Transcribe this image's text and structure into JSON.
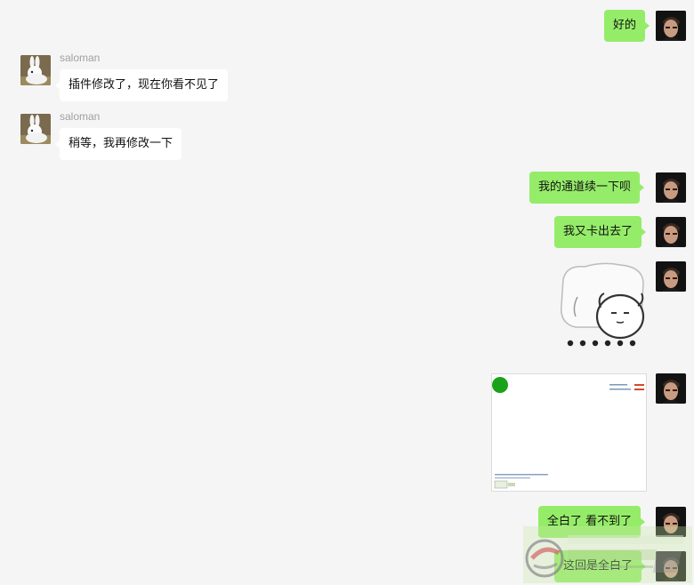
{
  "messages": [
    {
      "sender": "me",
      "type": "text",
      "text": "好的"
    },
    {
      "sender": "other",
      "type": "text",
      "name": "saloman",
      "text": "插件修改了，现在你看不见了"
    },
    {
      "sender": "other",
      "type": "text",
      "name": "saloman",
      "text": "稍等，我再修改一下"
    },
    {
      "sender": "me",
      "type": "text",
      "text": "我的通道续一下呗"
    },
    {
      "sender": "me",
      "type": "text",
      "text": "我又卡出去了"
    },
    {
      "sender": "me",
      "type": "image",
      "image": "cartoon-sticker"
    },
    {
      "sender": "me",
      "type": "image",
      "image": "screenshot"
    },
    {
      "sender": "me",
      "type": "text",
      "text": "全白了 看不到了"
    },
    {
      "sender": "me",
      "type": "text",
      "text": "这回是全白了"
    }
  ],
  "colors": {
    "background": "#f5f5f5",
    "my_bubble": "#95ec69",
    "other_bubble": "#ffffff",
    "sender_name": "#a0a0a0"
  }
}
